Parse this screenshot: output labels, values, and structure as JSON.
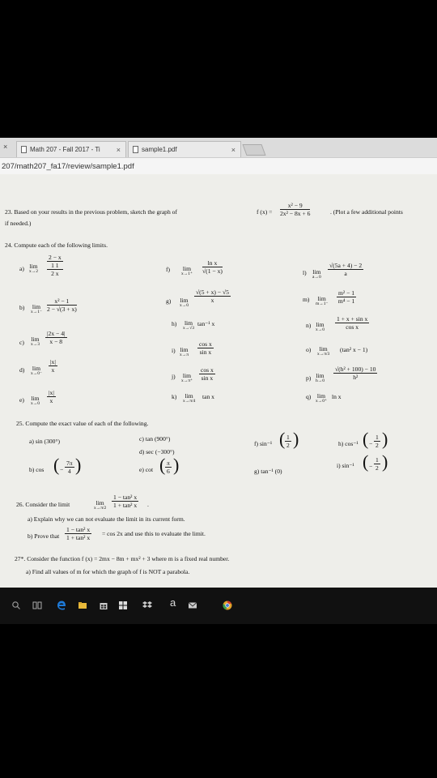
{
  "browser": {
    "tabs": [
      {
        "label": "Math 207 - Fall 2017 - Ti",
        "close": "×"
      },
      {
        "label": "sample1.pdf",
        "close": "×"
      }
    ],
    "left_close": "×",
    "url": "207/math207_fa17/review/sample1.pdf"
  },
  "doc": {
    "p23": {
      "text_a": "23.  Based on your results in the previous problem, sketch the graph of",
      "fx": "f (x) =",
      "num": "x² − 9",
      "den": "2x² − 8x + 6",
      "tail": ".  (Plot a few additional points",
      "line2": "if needed.)"
    },
    "p24": {
      "header": "24.  Compute each of the following limits.",
      "a": {
        "label": "a)",
        "lim": "lim",
        "sub": "x→2",
        "num": "2 − x",
        "den_top": "1     1",
        "den_bot": "2     x"
      },
      "b": {
        "label": "b)",
        "lim": "lim",
        "sub": "x→1⁻",
        "num": "x² − 1",
        "den": "2 − √(3 + x)"
      },
      "c": {
        "label": "c)",
        "lim": "lim",
        "sub": "x→3",
        "num": "|2x − 4|",
        "den": "x − 8"
      },
      "d": {
        "label": "d)",
        "lim": "lim",
        "sub": "x→0⁻",
        "num": "|x|",
        "den": "x"
      },
      "e": {
        "label": "e)",
        "lim": "lim",
        "sub": "x→0",
        "num": "|x|",
        "den": "x"
      },
      "f": {
        "label": "f)",
        "lim": "lim",
        "sub": "x→1⁺",
        "num": "ln x",
        "den": "√(1 − x)"
      },
      "g": {
        "label": "g)",
        "lim": "lim",
        "sub": "x→0",
        "num": "√(5 + x) − √5",
        "den": "x"
      },
      "h": {
        "label": "h)",
        "lim": "lim",
        "sub": "x→√3",
        "expr": "tan⁻¹ x"
      },
      "i": {
        "label": "i)",
        "lim": "lim",
        "sub": "x→π",
        "num": "cos x",
        "den": "sin x"
      },
      "j": {
        "label": "j)",
        "lim": "lim",
        "sub": "x→π⁺",
        "num": "cos x",
        "den": "sin x"
      },
      "k": {
        "label": "k)",
        "lim": "lim",
        "sub": "x→π/4",
        "expr": "tan x"
      },
      "l": {
        "label": "l)",
        "lim": "lim",
        "sub": "a→0",
        "num": "√(5a + 4) − 2",
        "den": "a"
      },
      "m": {
        "label": "m)",
        "lim": "lim",
        "sub": "m→1⁻",
        "num": "m² − 1",
        "den": "m⁴ − 1"
      },
      "n": {
        "label": "n)",
        "lim": "lim",
        "sub": "x→0",
        "num": "1 + x + sin x",
        "den": "cos x"
      },
      "o": {
        "label": "o)",
        "lim": "lim",
        "sub": "x→π/3",
        "expr": "(tan² x − 1)"
      },
      "p": {
        "label": "p)",
        "lim": "lim",
        "sub": "h→0",
        "num": "√(h² + 100) − 10",
        "den": "h²"
      },
      "q": {
        "label": "q)",
        "lim": "lim",
        "sub": "x→0⁺",
        "expr": "ln x"
      }
    },
    "p25": {
      "header": "25.  Compute the exact value of each of the following.",
      "a": "a)  sin (300°)",
      "b_label": "b)  cos",
      "b_num": "7π",
      "b_den": "4",
      "b_sign": "−",
      "c": "c)  tan (900°)",
      "d": "d)  sec (−300°)",
      "e_label": "e)  cot",
      "e_num": "π",
      "e_den": "6",
      "f_label": "f)  sin⁻¹",
      "f_num": "1",
      "f_den": "2",
      "g": "g)  tan⁻¹ (0)",
      "h_label": "h)  cos⁻¹",
      "h_num": "1",
      "h_den": "2",
      "h_sign": "−",
      "i_label": "i)  sin⁻¹",
      "i_num": "1",
      "i_den": "2",
      "i_sign": "−"
    },
    "p26": {
      "header": "26.  Consider the limit",
      "lim": "lim",
      "sub": "x→π/2",
      "num": "1 − tan² x",
      "den": "1 + tan² x",
      "period": ".",
      "a": "a)  Explain why we can not evaluate the limit in its current form.",
      "b_label": "b)  Prove that",
      "b_num": "1 − tan² x",
      "b_den": "1 + tan² x",
      "b_tail": "= cos 2x and use this to evaluate the limit."
    },
    "p27": {
      "header": "27*.  Consider the function f (x) = 2mx − 8m + mx² + 3 where m is a fixed real number.",
      "a": "a)  Find all values of m for which the graph of f is NOT a parabola."
    }
  },
  "taskbar": {
    "icons": [
      "search-icon",
      "task-view-icon",
      "edge-icon",
      "file-explorer-icon",
      "store-icon",
      "dropbox-icon",
      "amazon-icon",
      "mail-icon",
      "chrome-icon"
    ],
    "amazon_glyph": "a"
  }
}
